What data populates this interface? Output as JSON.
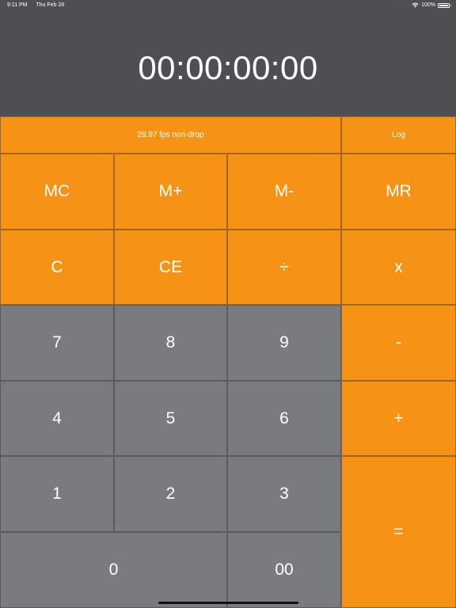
{
  "status_bar": {
    "time": "9:11 PM",
    "date": "Thu Feb 28",
    "battery": "100%",
    "signal_icon": "cellular-dots-icon",
    "wifi_icon": "wifi-icon",
    "battery_icon": "battery-icon"
  },
  "display": {
    "timecode": "00:00:00:00"
  },
  "top_bar": {
    "frame_rate": "29.97 fps non-drop",
    "log": "Log"
  },
  "keys": {
    "mc": "MC",
    "m_plus": "M+",
    "m_minus": "M-",
    "mr": "MR",
    "clear": "C",
    "clear_entry": "CE",
    "divide": "÷",
    "multiply": "x",
    "seven": "7",
    "eight": "8",
    "nine": "9",
    "minus": "-",
    "four": "4",
    "five": "5",
    "six": "6",
    "plus": "+",
    "one": "1",
    "two": "2",
    "three": "3",
    "equals": "=",
    "zero": "0",
    "double_zero": "00"
  },
  "colors": {
    "accent_orange": "#f79314",
    "key_gray": "#7a7b7e",
    "display_background": "#4f4f53"
  }
}
